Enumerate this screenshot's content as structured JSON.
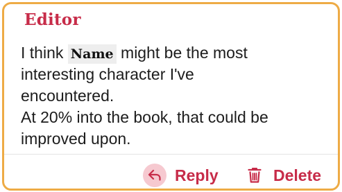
{
  "comment": {
    "author": "Editor",
    "timestamp": "",
    "text_before": "I think ",
    "highlight": "Name",
    "text_line1_after": " might be the most",
    "text_line2": "interesting character I've",
    "text_line3": "encountered.",
    "text_line4": "At 20% into the book, that could be",
    "text_line5": "improved upon."
  },
  "actions": {
    "reply_label": "Reply",
    "reply_icon": "reply-arrow-icon",
    "delete_label": "Delete",
    "delete_icon": "trash-icon"
  },
  "colors": {
    "border": "#eeab45",
    "accent": "#c72c49",
    "reply_icon_bg": "#f6c9d0"
  }
}
